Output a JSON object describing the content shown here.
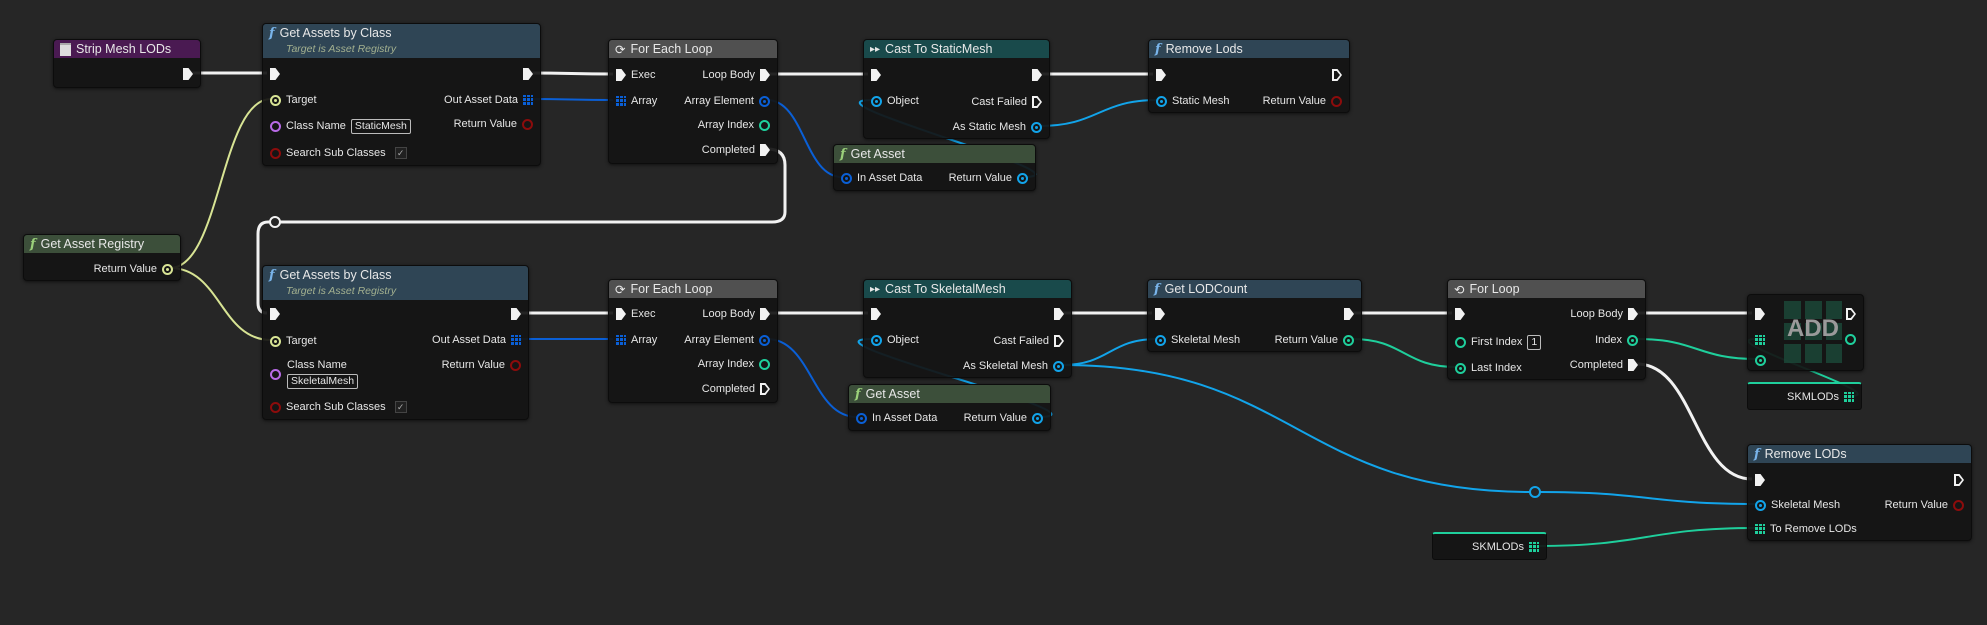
{
  "pin_colors": {
    "exec": "#f2f2f2",
    "asset_registry": "#d8e494",
    "class": "#b86ae6",
    "bool": "#8c0c0c",
    "asset_data": "#0a5fd6",
    "object": "#12a4ea",
    "int": "#1fcf9c"
  },
  "header_colors": {
    "function": "#2f4555",
    "pure": "#3c4f3a",
    "macro": "#505050",
    "cast": "#194a4b",
    "event": "#4a1a52"
  },
  "nodes": {
    "strip": {
      "title": "Strip Mesh LODs"
    },
    "gabc1": {
      "title": "Get Assets by Class",
      "subtitle": "Target is Asset Registry",
      "target": "Target",
      "class_name": "Class Name",
      "class_value": "StaticMesh",
      "search": "Search Sub Classes",
      "search_checked": true,
      "out_asset": "Out Asset Data",
      "return": "Return Value"
    },
    "gar": {
      "title": "Get Asset Registry",
      "return": "Return Value"
    },
    "gabc2": {
      "title": "Get Assets by Class",
      "subtitle": "Target is Asset Registry",
      "target": "Target",
      "class_name": "Class Name",
      "class_value": "SkeletalMesh",
      "search": "Search Sub Classes",
      "search_checked": true,
      "out_asset": "Out Asset Data",
      "return": "Return Value"
    },
    "fel1": {
      "title": "For Each Loop",
      "exec": "Exec",
      "array": "Array",
      "loop_body": "Loop Body",
      "element": "Array Element",
      "index": "Array Index",
      "completed": "Completed"
    },
    "fel2": {
      "title": "For Each Loop",
      "exec": "Exec",
      "array": "Array",
      "loop_body": "Loop Body",
      "element": "Array Element",
      "index": "Array Index",
      "completed": "Completed"
    },
    "cast1": {
      "title": "Cast To StaticMesh",
      "object": "Object",
      "failed": "Cast Failed",
      "as": "As Static Mesh"
    },
    "cast2": {
      "title": "Cast To SkeletalMesh",
      "object": "Object",
      "failed": "Cast Failed",
      "as": "As Skeletal Mesh"
    },
    "ga1": {
      "title": "Get Asset",
      "in": "In Asset Data",
      "return": "Return Value"
    },
    "ga2": {
      "title": "Get Asset",
      "in": "In Asset Data",
      "return": "Return Value"
    },
    "rl1": {
      "title": "Remove Lods",
      "mesh": "Static Mesh",
      "return": "Return Value"
    },
    "lodc": {
      "title": "Get LODCount",
      "mesh": "Skeletal Mesh",
      "return": "Return Value"
    },
    "forloop": {
      "title": "For Loop",
      "first": "First Index",
      "first_value": "1",
      "last": "Last Index",
      "loop_body": "Loop Body",
      "index": "Index",
      "completed": "Completed"
    },
    "add": {
      "label": "ADD"
    },
    "var1": {
      "name": "SKMLODs"
    },
    "rl2": {
      "title": "Remove LODs",
      "mesh": "Skeletal Mesh",
      "to_remove": "To Remove LODs",
      "return": "Return Value"
    },
    "var2": {
      "name": "SKMLODs"
    }
  }
}
